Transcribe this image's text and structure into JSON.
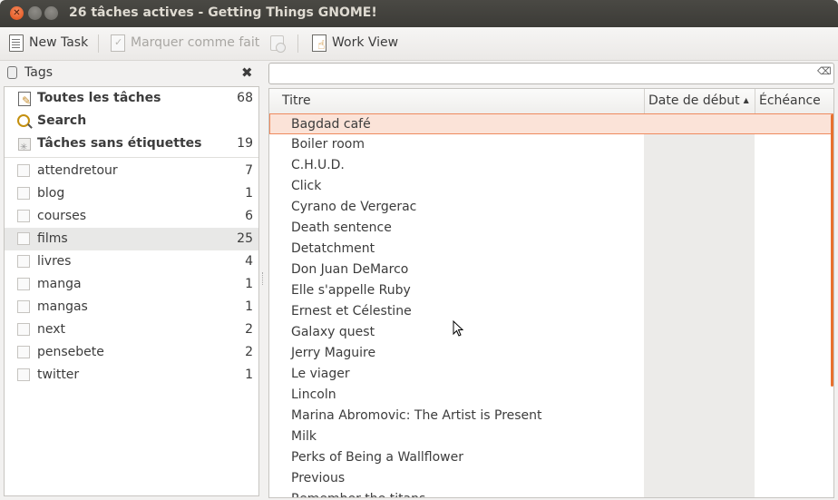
{
  "window": {
    "title": "26 tâches actives - Getting Things GNOME!"
  },
  "toolbar": {
    "new_task": "New Task",
    "mark_done": "Marquer comme fait",
    "work_view": "Work View"
  },
  "sidebar": {
    "header": "Tags",
    "special": [
      {
        "label": "Toutes les tâches",
        "count": "68",
        "icon": "all-tasks-icon"
      },
      {
        "label": "Search",
        "count": "",
        "icon": "search-icon"
      },
      {
        "label": "Tâches sans étiquettes",
        "count": "19",
        "icon": "no-tags-icon"
      }
    ],
    "tags": [
      {
        "label": "attendretour",
        "count": "7"
      },
      {
        "label": "blog",
        "count": "1"
      },
      {
        "label": "courses",
        "count": "6"
      },
      {
        "label": "films",
        "count": "25",
        "selected": true
      },
      {
        "label": "livres",
        "count": "4"
      },
      {
        "label": "manga",
        "count": "1"
      },
      {
        "label": "mangas",
        "count": "1"
      },
      {
        "label": "next",
        "count": "2"
      },
      {
        "label": "pensebete",
        "count": "2"
      },
      {
        "label": "twitter",
        "count": "1"
      }
    ]
  },
  "task_list": {
    "columns": [
      "Titre",
      "Date de début",
      "Échéance"
    ],
    "tasks": [
      "Bagdad café",
      "Boiler room",
      "C.H.U.D.",
      "Click",
      "Cyrano de Vergerac",
      "Death sentence",
      "Detatchment",
      "Don Juan DeMarco",
      "Elle s'appelle Ruby",
      "Ernest et Célestine",
      "Galaxy quest",
      "Jerry Maguire",
      "Le viager",
      "Lincoln",
      "Marina Abromovic: The Artist is Present",
      "Milk",
      "Perks of Being a Wallflower",
      "Previous",
      "Remember the titans"
    ],
    "selected_index": 0
  },
  "colors": {
    "accent": "#e8712f",
    "selection_bg": "#fbe3d8",
    "titlebar": "#3c3b37"
  }
}
